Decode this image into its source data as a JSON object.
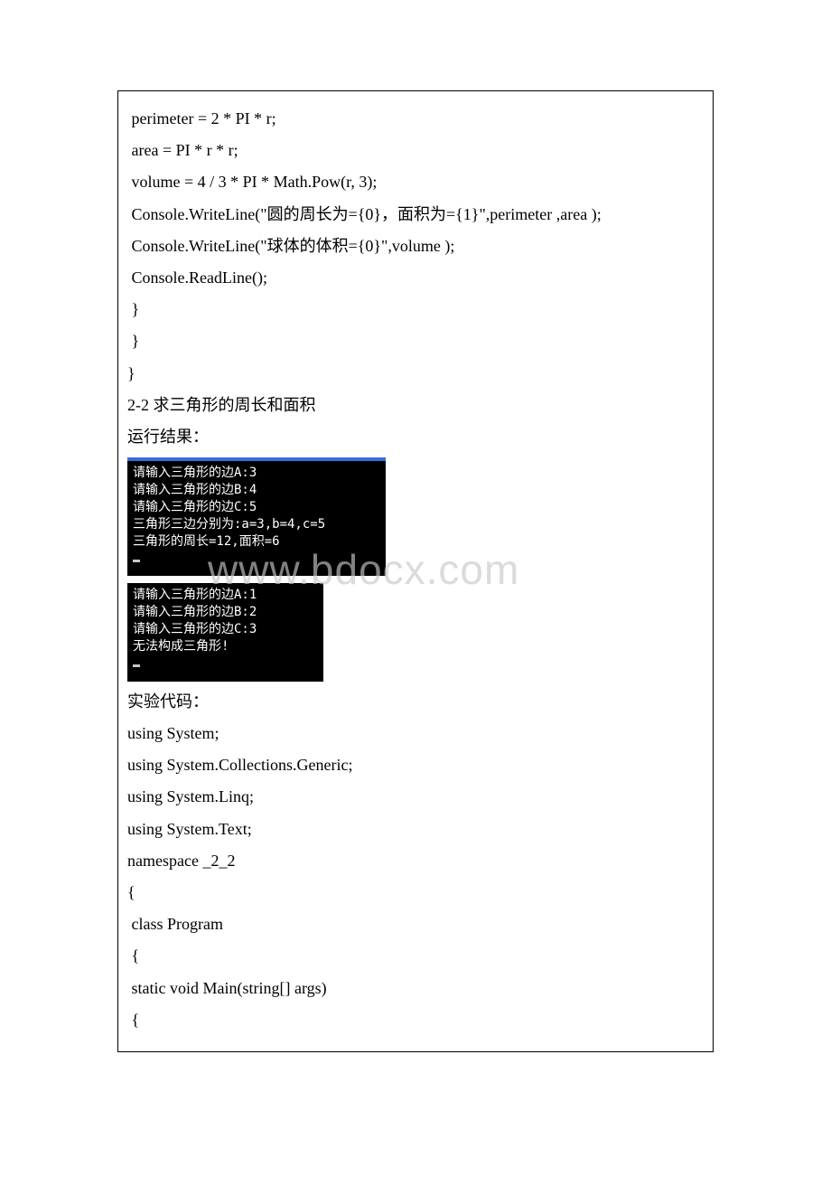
{
  "code_top": {
    "l1": " perimeter = 2 * PI * r;",
    "l2": " area = PI * r * r;",
    "l3": " volume = 4 / 3 * PI * Math.Pow(r, 3);",
    "l4": " Console.WriteLine(\"圆的周长为={0}，面积为={1}\",perimeter ,area );",
    "l5": " Console.WriteLine(\"球体的体积={0}\",volume );",
    "l6": " Console.ReadLine();",
    "l7": " }",
    "l8": " }",
    "l9": "}"
  },
  "heading": "2-2 求三角形的周长和面积",
  "run_result_label": "运行结果：",
  "console1": {
    "l1": "请输入三角形的边A:3",
    "l2": "请输入三角形的边B:4",
    "l3": "请输入三角形的边C:5",
    "l4": "三角形三边分别为:a=3,b=4,c=5",
    "l5": "三角形的周长=12,面积=6"
  },
  "console2": {
    "l1": "请输入三角形的边A:1",
    "l2": "请输入三角形的边B:2",
    "l3": "请输入三角形的边C:3",
    "l4": "无法构成三角形!"
  },
  "code_label": "实验代码：",
  "code_bottom": {
    "l1": "using System;",
    "l2": "using System.Collections.Generic;",
    "l3": "using System.Linq;",
    "l4": "using System.Text;",
    "l5": "namespace _2_2",
    "l6": "{",
    "l7": " class Program",
    "l8": " {",
    "l9": " static void Main(string[] args)",
    "l10": " {"
  },
  "watermark": "www.bdocx.com"
}
